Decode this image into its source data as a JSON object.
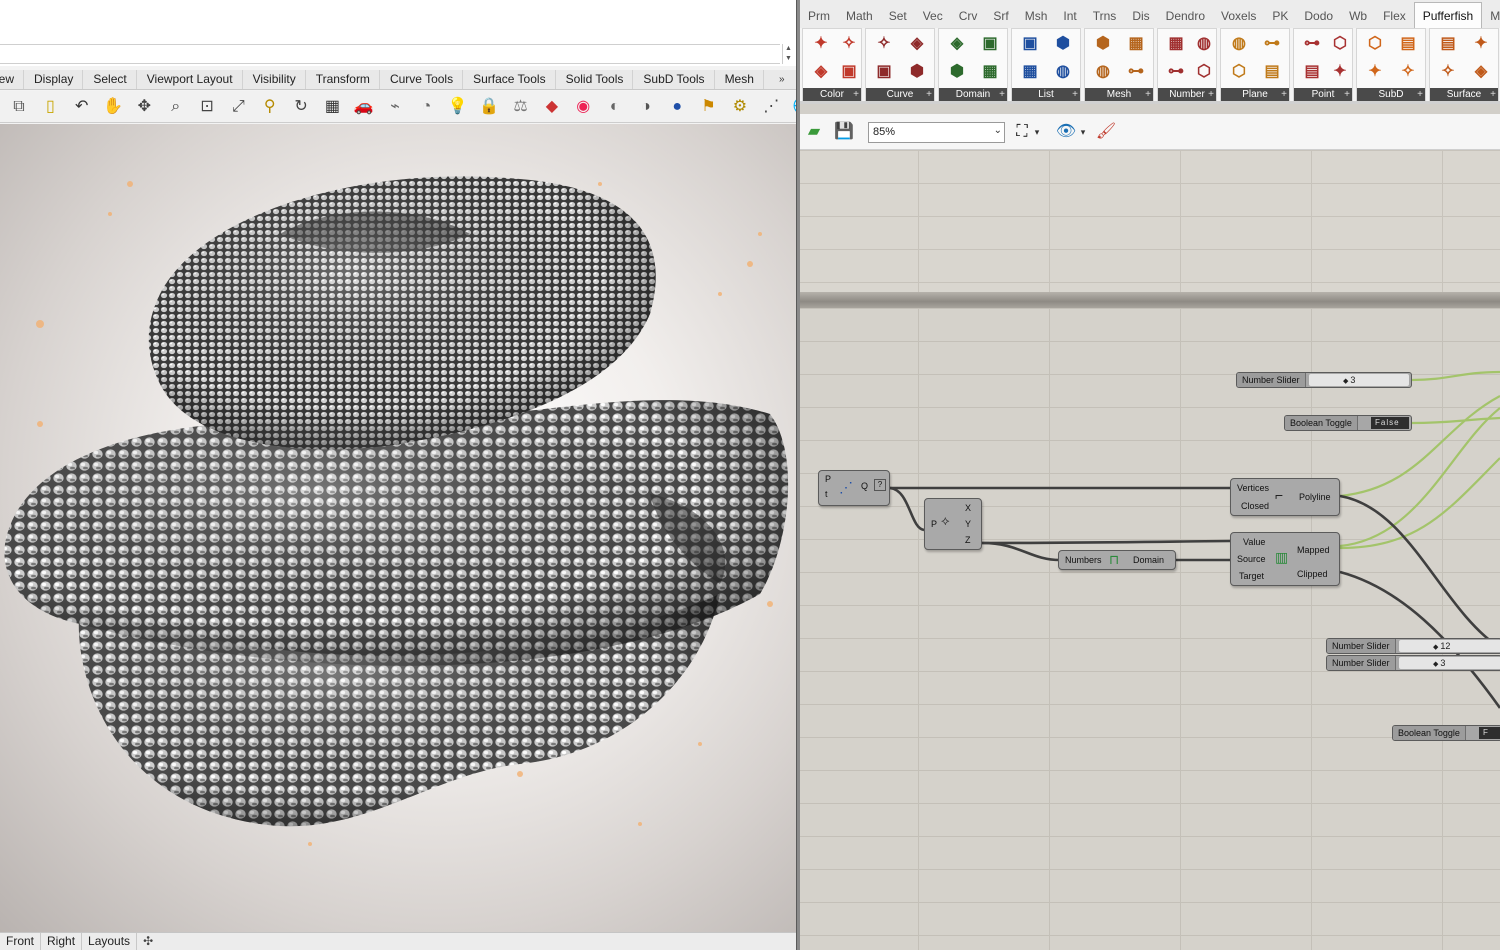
{
  "rhino": {
    "tabs": [
      "iew",
      "Display",
      "Select",
      "Viewport Layout",
      "Visibility",
      "Transform",
      "Curve Tools",
      "Surface Tools",
      "Solid Tools",
      "SubD Tools",
      "Mesh"
    ],
    "tabs_more": "»",
    "toolbar_icons": [
      "copy-icon",
      "paste-icon",
      "undo-icon",
      "pan-hand-icon",
      "move-icon",
      "zoom-icon",
      "zoom-window-icon",
      "zoom-extents-icon",
      "zoom-selected-icon",
      "rotate-view-icon",
      "four-views-icon",
      "car-icon",
      "snap-icon",
      "clock-icon",
      "light-icon",
      "lock-icon",
      "match-icon",
      "paint-icon",
      "color-wheel-icon",
      "shaded-icon",
      "render-icon",
      "sphere-icon",
      "flag-icon",
      "gear-icon",
      "points-icon",
      "globe-icon",
      "help-icon"
    ],
    "view_tabs": [
      "Front",
      "Right",
      "Layouts"
    ],
    "view_tab_add": "✣"
  },
  "gh": {
    "tabs": [
      "Prm",
      "Math",
      "Set",
      "Vec",
      "Crv",
      "Srf",
      "Msh",
      "Int",
      "Trns",
      "Dis",
      "Dendro",
      "Voxels",
      "PK",
      "Dodo",
      "Wb",
      "Flex",
      "Pufferfish",
      "M+"
    ],
    "active_tab": "Pufferfish",
    "panels": [
      {
        "label": "Color",
        "w": 60
      },
      {
        "label": "Curve",
        "w": 70
      },
      {
        "label": "Domain",
        "w": 70
      },
      {
        "label": "List",
        "w": 70
      },
      {
        "label": "Mesh",
        "w": 70
      },
      {
        "label": "Number",
        "w": 60
      },
      {
        "label": "Plane",
        "w": 70
      },
      {
        "label": "Point",
        "w": 60
      },
      {
        "label": "SubD",
        "w": 70
      },
      {
        "label": "Surface",
        "w": 70
      }
    ],
    "zoom": "85%",
    "nodes": {
      "slider1": {
        "label": "Number Slider",
        "value": "3"
      },
      "toggle1": {
        "label": "Boolean Toggle",
        "value": "False"
      },
      "polyline": {
        "in1": "Vertices",
        "in2": "Closed",
        "out": "Polyline"
      },
      "points": {
        "in1": "P",
        "in2": "t",
        "out": "Q"
      },
      "deconstruct": {
        "in": "P",
        "out1": "X",
        "out2": "Y",
        "out3": "Z"
      },
      "bounds": {
        "in": "Numbers",
        "out": "Domain"
      },
      "remap": {
        "in1": "Value",
        "in2": "Source",
        "in3": "Target",
        "out1": "Mapped",
        "out2": "Clipped"
      },
      "slider2": {
        "label": "Number Slider",
        "value": "12"
      },
      "slider3": {
        "label": "Number Slider",
        "value": "3"
      },
      "toggle2": {
        "label": "Boolean Toggle",
        "value": "F"
      }
    }
  },
  "colors": {
    "wire_dark": "#3f3f3f",
    "wire_green": "#a3c46a",
    "component": "#a9a9a9",
    "canvas": "#d5d2cb",
    "active_tab_panel": "#4a4a4a"
  }
}
